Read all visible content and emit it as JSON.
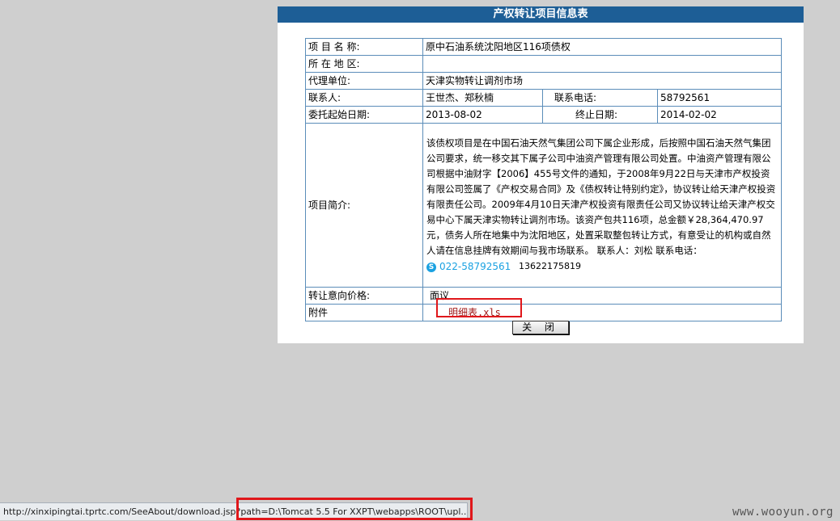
{
  "panel": {
    "title": "产权转让项目信息表",
    "close_label": "关 闭"
  },
  "fields": {
    "project_name_label": "项 目 名 称:",
    "project_name_value": "原中石油系统沈阳地区116项债权",
    "location_label": "所 在 地 区:",
    "location_value": "",
    "agency_label": "代理单位:",
    "agency_value": "天津实物转让调剂市场",
    "contact_label": "联系人:",
    "contact_value": "王世杰、郑秋楠",
    "phone_label": "联系电话:",
    "phone_value": "58792561",
    "start_date_label": "委托起始日期:",
    "start_date_value": "2013-08-02",
    "end_date_label": "终止日期:",
    "end_date_value": "2014-02-02",
    "intro_label": "项目简介:",
    "intro_text": "该债权项目是在中国石油天然气集团公司下属企业形成，后按照中国石油天然气集团公司要求，统一移交其下属子公司中油资产管理有限公司处置。中油资产管理有限公司根据中油财字【2006】455号文件的通知，于2008年9月22日与天津市产权投资有限公司签属了《产权交易合同》及《债权转让特别约定》，协议转让给天津产权投资有限责任公司。2009年4月10日天津产权投资有限责任公司又协议转让给天津产权交易中心下属天津实物转让调剂市场。该资产包共116项，总金额￥28,364,470.97 元，债务人所在地集中为沈阳地区，处置采取整包转让方式，有意受让的机构或自然人请在信息挂牌有效期间与我市场联系。 联系人：刘松 联系电话：",
    "intro_skype_number": "022-58792561",
    "intro_mobile": "13622175819",
    "price_label": "转让意向价格:",
    "price_value": "面议",
    "attachment_label": "附件",
    "attachment_link": "明细表.xls"
  },
  "statusbar": {
    "url": "http://xinxipingtai.tprtc.com/SeeAbout/download.jsp?path=D:\\Tomcat 5.5 For XXPT\\webapps\\ROOT\\upl..."
  },
  "watermark": "www.wooyun.org",
  "colors": {
    "header_bg": "#1d5e96",
    "border": "#5b8db9",
    "highlight": "#e0171b",
    "link": "#a01818",
    "skype": "#1aa1e1"
  }
}
